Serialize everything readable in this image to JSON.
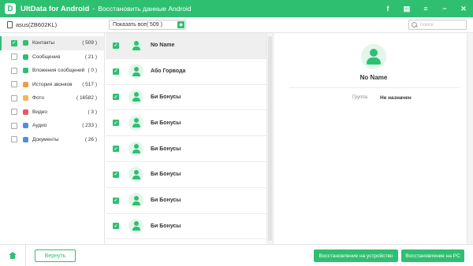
{
  "titlebar": {
    "app_name": "UltData for Android",
    "separator": "-",
    "subtitle": "Восстановить данные Android",
    "logo_letter": "D",
    "icons": [
      "facebook-icon",
      "feedback-icon",
      "menu-icon",
      "minimize-icon",
      "close-icon"
    ],
    "facebook_glyph": "f",
    "menu_glyph": "≡",
    "minimize_glyph": "−",
    "close_glyph": "✕",
    "feedback_glyph": "▤",
    "brand_color": "#2fbf71"
  },
  "toolbar": {
    "device_name": "asus(ZB602KL)",
    "filter_label": "Показать все( 509 )",
    "search_placeholder": "поиск"
  },
  "sidebar": {
    "items": [
      {
        "label": "Контакты",
        "count": "( 509 )",
        "checked": true,
        "active": true,
        "icon": "contacts-icon",
        "icon_color": "#2fbf71"
      },
      {
        "label": "Сообщения",
        "count": "( 21 )",
        "checked": false,
        "active": false,
        "icon": "messages-icon",
        "icon_color": "#2fbf71"
      },
      {
        "label": "Вложения сообщений",
        "count": "( 0 )",
        "checked": false,
        "active": false,
        "icon": "attachments-icon",
        "icon_color": "#2fbf71"
      },
      {
        "label": "История звонков",
        "count": "( 517 )",
        "checked": false,
        "active": false,
        "icon": "call-history-icon",
        "icon_color": "#f39c3c"
      },
      {
        "label": "Фото",
        "count": "( 16582 )",
        "checked": false,
        "active": false,
        "icon": "photo-icon",
        "icon_color": "#f5b942"
      },
      {
        "label": "Видео",
        "count": "( 3 )",
        "checked": false,
        "active": false,
        "icon": "video-icon",
        "icon_color": "#e85a5a"
      },
      {
        "label": "Аудио",
        "count": "( 233 )",
        "checked": false,
        "active": false,
        "icon": "audio-icon",
        "icon_color": "#4a90e2"
      },
      {
        "label": "Документы",
        "count": "( 26 )",
        "checked": false,
        "active": false,
        "icon": "documents-icon",
        "icon_color": "#4a90e2"
      }
    ]
  },
  "contacts": [
    {
      "name": "No Name",
      "checked": true,
      "selected": true
    },
    {
      "name": "Або Горвода",
      "checked": true,
      "selected": false
    },
    {
      "name": "Би Бонусы",
      "checked": true,
      "selected": false
    },
    {
      "name": "Би Бонусы",
      "checked": true,
      "selected": false
    },
    {
      "name": "Би Бонусы",
      "checked": true,
      "selected": false
    },
    {
      "name": "Би Бонусы",
      "checked": true,
      "selected": false
    },
    {
      "name": "Би Бонусы",
      "checked": true,
      "selected": false
    },
    {
      "name": "Би Бонусы",
      "checked": true,
      "selected": false
    }
  ],
  "detail": {
    "name": "No Name",
    "field_label": "Группа",
    "field_value": "Не назначен"
  },
  "bottom": {
    "back_label": "Вернуть",
    "restore_device_label": "Восстановление на устройство",
    "restore_pc_label": "Восстановление на PC"
  }
}
